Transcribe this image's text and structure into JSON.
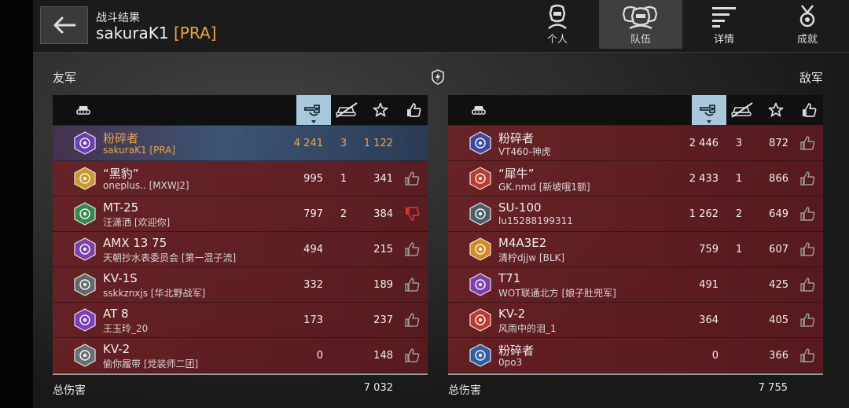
{
  "header": {
    "title": "战斗结果",
    "player_name": "sakuraK1",
    "player_clan": "[PRA]"
  },
  "tabs": [
    {
      "label": "个人",
      "icon": "personal-icon"
    },
    {
      "label": "队伍",
      "icon": "team-icon",
      "active": true
    },
    {
      "label": "详情",
      "icon": "details-icon"
    },
    {
      "label": "成就",
      "icon": "medal-icon"
    }
  ],
  "allies": {
    "label": "友军",
    "total_label": "总伤害",
    "total_damage": "7 032",
    "rows": [
      {
        "vehicle": "粉碎者",
        "player": "sakuraK1 [PRA]",
        "damage": "4 241",
        "kills": "3",
        "xp": "1 122",
        "badge_color": "#6a3fb5"
      },
      {
        "vehicle": "“黑豹”",
        "player": "oneplus.. [MXWJ2]",
        "damage": "995",
        "kills": "1",
        "xp": "341",
        "badge_color": "#c79a2a"
      },
      {
        "vehicle": "MT-25",
        "player": "汪潇洒 [欢迎你]",
        "damage": "797",
        "kills": "2",
        "xp": "384",
        "badge_color": "#2e8b4a",
        "disliked": true
      },
      {
        "vehicle": "AMX 13 75",
        "player": "天朝抄水表委员会 [第一混子流]",
        "damage": "494",
        "kills": "",
        "xp": "215",
        "badge_color": "#7a3fb0"
      },
      {
        "vehicle": "KV-1S",
        "player": "sskkznxjs [华北野战军]",
        "damage": "332",
        "kills": "",
        "xp": "189",
        "badge_color": "#5f6a6a"
      },
      {
        "vehicle": "AT 8",
        "player": "王玉玲_20",
        "damage": "173",
        "kills": "",
        "xp": "237",
        "badge_color": "#7d3cc4"
      },
      {
        "vehicle": "KV-2",
        "player": "偷你履带 [党装师二团]",
        "damage": "0",
        "kills": "",
        "xp": "148",
        "badge_color": "#666f73"
      }
    ]
  },
  "enemies": {
    "label": "敌军",
    "total_label": "总伤害",
    "total_damage": "7 755",
    "rows": [
      {
        "vehicle": "粉碎者",
        "player": "VT460-神虎",
        "damage": "2 446",
        "kills": "3",
        "xp": "872",
        "badge_color": "#3b4aa0"
      },
      {
        "vehicle": "“犀牛”",
        "player": "GK.nmd [新坡哦1额]",
        "damage": "2 433",
        "kills": "1",
        "xp": "866",
        "badge_color": "#c0392b"
      },
      {
        "vehicle": "SU-100",
        "player": "lu15288199311",
        "damage": "1 262",
        "kills": "2",
        "xp": "649",
        "badge_color": "#4a5f6a"
      },
      {
        "vehicle": "M4A3E2",
        "player": "清柠djjw [BLK]",
        "damage": "759",
        "kills": "1",
        "xp": "607",
        "badge_color": "#d68a1e"
      },
      {
        "vehicle": "T71",
        "player": "WOT联通北方 [娘子肚兜军]",
        "damage": "491",
        "kills": "",
        "xp": "425",
        "badge_color": "#7a3fb0"
      },
      {
        "vehicle": "KV-2",
        "player": "风雨中的泪_1",
        "damage": "364",
        "kills": "",
        "xp": "405",
        "badge_color": "#c0392b"
      },
      {
        "vehicle": "粉碎者",
        "player": "0po3",
        "damage": "0",
        "kills": "",
        "xp": "366",
        "badge_color": "#2b5fa8"
      }
    ]
  },
  "colors": {
    "clan_accent": "#f2a33a",
    "selected_column": "#a8c9dc",
    "row_red": "#70202a",
    "dislike_red": "#e03030"
  }
}
